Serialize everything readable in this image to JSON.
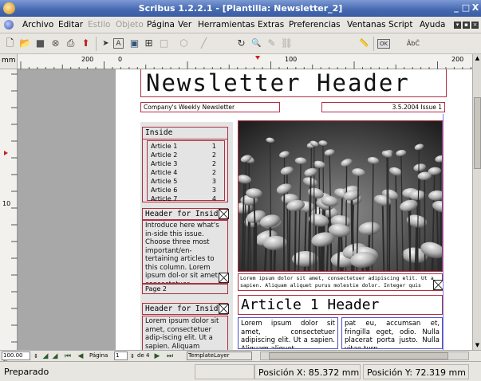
{
  "window": {
    "title": "Scribus 1.2.2.1 - [Plantilla: Newsletter_2]",
    "controls": [
      "_",
      "□",
      "X"
    ]
  },
  "menubar": {
    "items": [
      {
        "label": "Archivo",
        "enabled": true
      },
      {
        "label": "Editar",
        "enabled": true
      },
      {
        "label": "Estilo",
        "enabled": false
      },
      {
        "label": "Objeto",
        "enabled": false
      },
      {
        "label": "Página",
        "enabled": true
      },
      {
        "label": "Ver",
        "enabled": true
      },
      {
        "label": "Herramientas",
        "enabled": true
      },
      {
        "label": "Extras",
        "enabled": true
      },
      {
        "label": "Preferencias",
        "enabled": true
      },
      {
        "label": "Ventanas",
        "enabled": true
      },
      {
        "label": "Script",
        "enabled": true
      },
      {
        "label": "Ayuda",
        "enabled": true
      }
    ]
  },
  "toolbar": {
    "buttons": [
      {
        "icon": "new-document-icon",
        "glyph": "🗋"
      },
      {
        "icon": "open-folder-icon",
        "glyph": "📂"
      },
      {
        "icon": "save-icon",
        "glyph": "■"
      },
      {
        "icon": "close-icon",
        "glyph": "⊗"
      },
      {
        "icon": "print-icon",
        "glyph": "⎙"
      },
      {
        "icon": "pdf-icon",
        "glyph": "⬆"
      },
      {
        "icon": "select-arrow-icon",
        "glyph": "➤"
      },
      {
        "icon": "text-frame-icon",
        "glyph": "A"
      },
      {
        "icon": "image-frame-icon",
        "glyph": "▣"
      },
      {
        "icon": "table-icon",
        "glyph": "⊞"
      },
      {
        "icon": "rectangle-icon",
        "glyph": "□"
      },
      {
        "icon": "polygon-icon",
        "glyph": "⬡"
      },
      {
        "icon": "line-icon",
        "glyph": "╱"
      },
      {
        "icon": "rotate-icon",
        "glyph": "↻"
      },
      {
        "icon": "zoom-icon",
        "glyph": "🔍"
      },
      {
        "icon": "edit-contents-icon",
        "glyph": "✎"
      },
      {
        "icon": "link-frames-icon",
        "glyph": "⛓"
      },
      {
        "icon": "measure-icon",
        "glyph": "📏"
      },
      {
        "icon": "pdf-ok-icon",
        "glyph": "OK"
      },
      {
        "icon": "text-style-icon",
        "glyph": "ÂbČ"
      }
    ]
  },
  "rulers": {
    "unit": "mm",
    "h_ticks": [
      "200",
      "0",
      "100",
      "200"
    ],
    "v_ticks": [
      "10"
    ]
  },
  "document": {
    "header": "Newsletter Header",
    "tagline": "Company's Weekly Newsletter",
    "issue": "3.5.2004 Issue 1",
    "inside_title": "Inside",
    "inside_items": [
      {
        "label": "Article 1",
        "page": "1"
      },
      {
        "label": "Article 2",
        "page": "2"
      },
      {
        "label": "Article 3",
        "page": "2"
      },
      {
        "label": "Article 4",
        "page": "2"
      },
      {
        "label": "Article 5",
        "page": "3"
      },
      {
        "label": "Article 6",
        "page": "3"
      },
      {
        "label": "Article 7",
        "page": "4"
      }
    ],
    "side_header_1": "Header for Inside",
    "side_body_1": "Introduce here what's in-side this issue. Choose three most important/en-tertaining articles to this column. Lorem ipsum dol-or sit amet, consectetuer adipiscing elit. Ut a sap",
    "page_label": "Page 2",
    "side_header_2": "Header for Inside",
    "side_body_2": "Lorem ipsum dolor sit amet, consectetuer adip-iscing elit. Ut a sapien. Aliquam aliquet purus",
    "caption": "Lorem ipsum dolor sit amet, consectetuer adipiscing elit. Ut a sapien. Aliquam aliquet purus molestie dolor. Integer quis",
    "article_header": "Article 1 Header",
    "article_col1": "Lorem ipsum dolor sit amet, consectetuer adipiscing elit. Ut a sapien. Aliquam aliquet",
    "article_col2": "pat eu, accumsan et, fringilla eget, odio. Nulla placerat porta justo. Nulla vitae turp-"
  },
  "bottombar": {
    "zoom": "100.00 %",
    "page_label": "Página",
    "page_value": "1",
    "page_of": "de 4",
    "layer": "TemplateLayer"
  },
  "statusbar": {
    "status": "Preparado",
    "pos_x": "Posición X: 85.372 mm",
    "pos_y": "Posición Y: 72.319 mm"
  }
}
